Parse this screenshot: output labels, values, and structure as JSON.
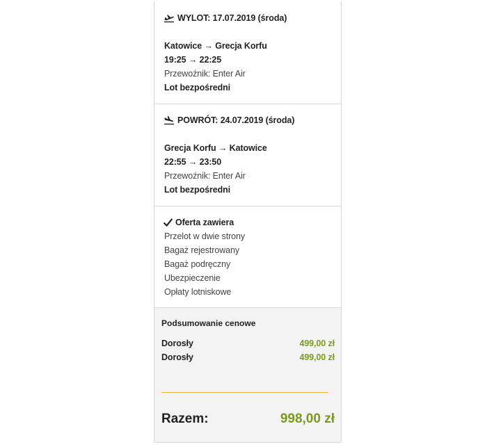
{
  "outbound": {
    "header": "WYLOT: 17.07.2019 (środa)",
    "route": "Katowice → Grecja Korfu",
    "times": "19:25 → 22:25",
    "carrier": "Przewoźnik: Enter Air",
    "type": "Lot bezpośredni",
    "icon": "plane-takeoff-icon"
  },
  "return": {
    "header": "POWRÓT: 24.07.2019 (środa)",
    "route": "Grecja Korfu → Katowice",
    "times": "22:55 → 23:50",
    "carrier": "Przewoźnik: Enter Air",
    "type": "Lot bezpośredni",
    "icon": "plane-landing-icon"
  },
  "includes": {
    "title": "Oferta zawiera",
    "icon": "checkmark-icon",
    "items": [
      "Przelot w dwie strony",
      "Bagaż rejestrowany",
      "Bagaż podręczny",
      "Ubezpieczenie",
      "Opłaty lotniskowe"
    ]
  },
  "summary": {
    "title": "Podsumowanie cenowe",
    "rows": [
      {
        "label": "Dorosły",
        "value": "499,00 zł"
      },
      {
        "label": "Dorosły",
        "value": "499,00 zł"
      }
    ],
    "total_label": "Razem:",
    "total_value": "998,00 zł"
  },
  "colors": {
    "price_green": "#7a9a1e",
    "divider_yellow": "#e5b53c",
    "summary_bg": "#f3f3f3",
    "border": "#d8d8d8"
  }
}
